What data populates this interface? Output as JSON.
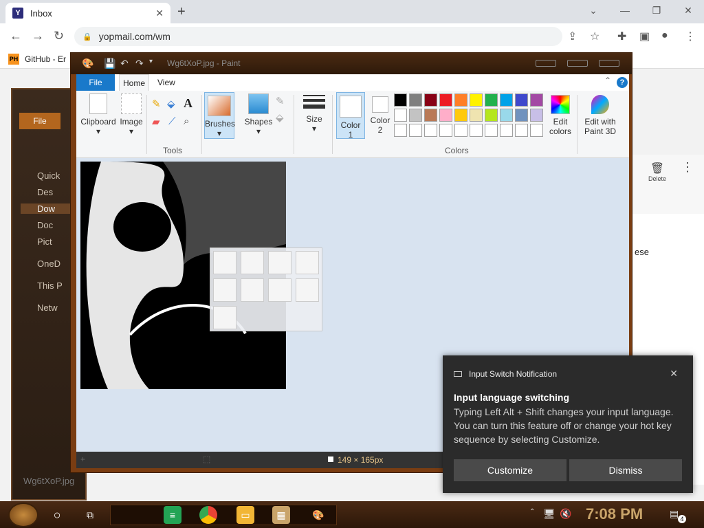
{
  "browser": {
    "tab_title": "Inbox",
    "tab_favicon": "Y",
    "url": "yopmail.com/wm",
    "bookmark_favicon": "PH",
    "bookmark_label": "GitHub - Er"
  },
  "explorer": {
    "file_tab": "File",
    "nav_items": [
      "Quick",
      "Des",
      "Dow",
      "Doc",
      "Pict",
      "OneD",
      "This P",
      "Netw"
    ],
    "footer": "Wg6tXoP.jpg"
  },
  "mail": {
    "delete_label": "Delete",
    "body_fragment": "ese"
  },
  "paint": {
    "window_title": "Wg6tXoP.jpg - Paint",
    "tabs": {
      "file": "File",
      "home": "Home",
      "view": "View"
    },
    "groups": {
      "clipboard": "Clipboard",
      "image": "Image",
      "tools": "Tools",
      "brushes": "Brushes",
      "shapes": "Shapes",
      "size": "Size",
      "color1": "Color\n1",
      "color2": "Color\n2",
      "colors": "Colors",
      "edit_colors": "Edit\ncolors",
      "edit_paint3d": "Edit with\nPaint 3D"
    },
    "palette": [
      "#000000",
      "#7f7f7f",
      "#880015",
      "#ed1c24",
      "#ff7f27",
      "#fff200",
      "#22b14c",
      "#00a2e8",
      "#3f48cc",
      "#a349a4",
      "#ffffff",
      "#c3c3c3",
      "#b97a57",
      "#ffaec9",
      "#ffc90e",
      "#efe4b0",
      "#b5e61d",
      "#99d9ea",
      "#7092be",
      "#c8bfe7",
      "#ffffff",
      "#ffffff",
      "#ffffff",
      "#ffffff",
      "#ffffff",
      "#ffffff",
      "#ffffff",
      "#ffffff",
      "#ffffff",
      "#ffffff"
    ],
    "color1": "#ffffff",
    "color2": "#ffffff",
    "status_size": "149 × 165px"
  },
  "notification": {
    "app": "Input Switch Notification",
    "title": "Input language switching",
    "body": "Typing Left Alt + Shift changes your input language. You can turn this feature off or change your hot key sequence by selecting Customize.",
    "customize": "Customize",
    "dismiss": "Dismiss"
  },
  "taskbar": {
    "clock": "7:08 PM",
    "notif_count": "4"
  }
}
